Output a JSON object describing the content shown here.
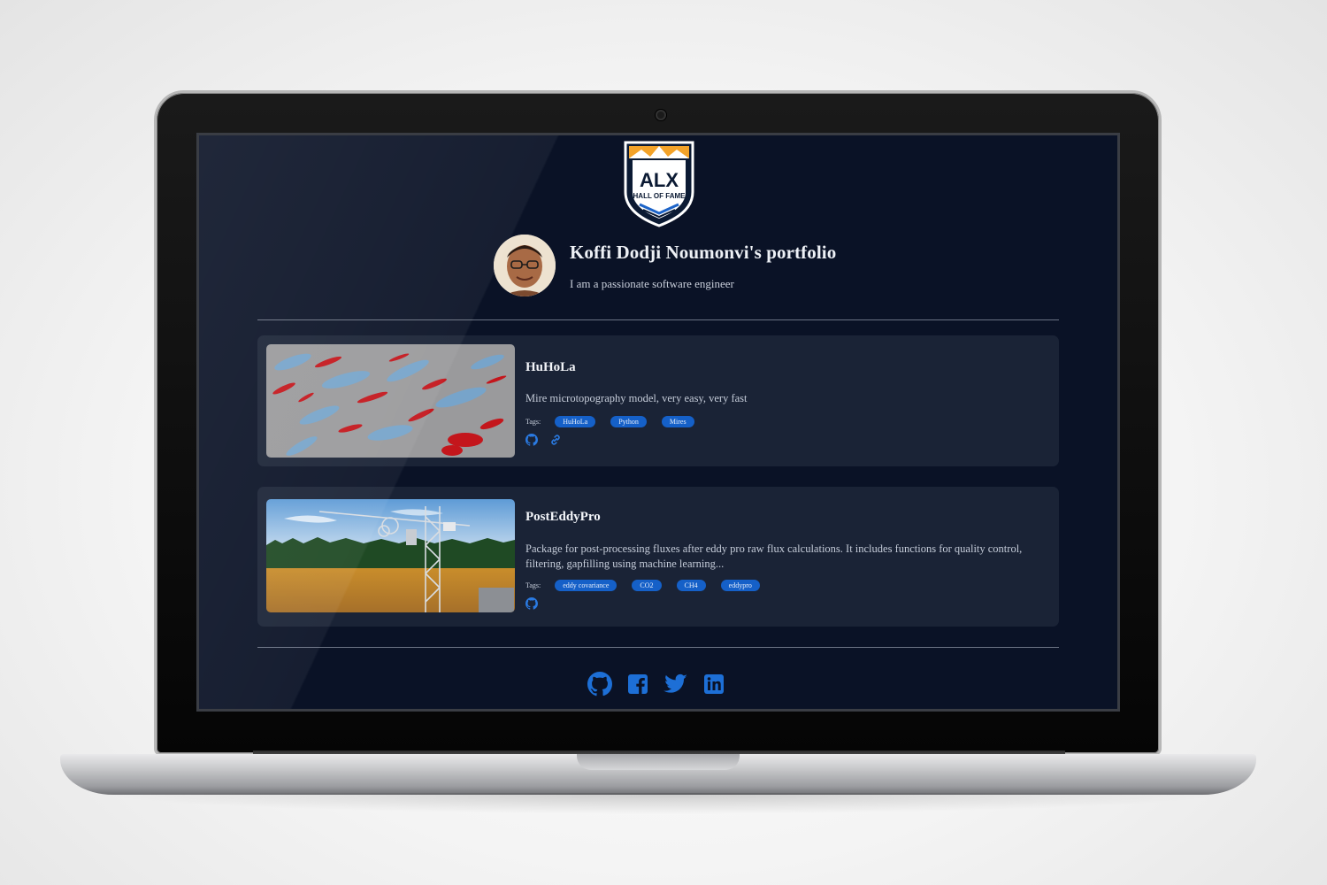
{
  "colors": {
    "screen_bg": "#0a1226",
    "card_bg": "#1a2336",
    "accent": "#1560c8",
    "link_icon": "#2a7ae2"
  },
  "logo": {
    "line1": "ALX",
    "line2": "HALL OF FAME"
  },
  "profile": {
    "title": "Koffi Dodji Noumonvi's portfolio",
    "subtitle": "I am a passionate software engineer"
  },
  "tags_label": "Tags:",
  "projects": [
    {
      "title": "HuHoLa",
      "description": "Mire microtopography model, very easy, very fast",
      "tags": [
        "HuHoLa",
        "Python",
        "Mires"
      ],
      "links": [
        "github-icon",
        "link-icon"
      ]
    },
    {
      "title": "PostEddyPro",
      "description": "Package for post-processing fluxes after eddy pro raw flux calculations. It includes functions for quality control, filtering, gapfilling using machine learning...",
      "tags": [
        "eddy covariance",
        "CO2",
        "CH4",
        "eddypro"
      ],
      "links": [
        "github-icon"
      ]
    }
  ],
  "social": [
    "github-icon",
    "facebook-icon",
    "twitter-icon",
    "linkedin-icon"
  ]
}
